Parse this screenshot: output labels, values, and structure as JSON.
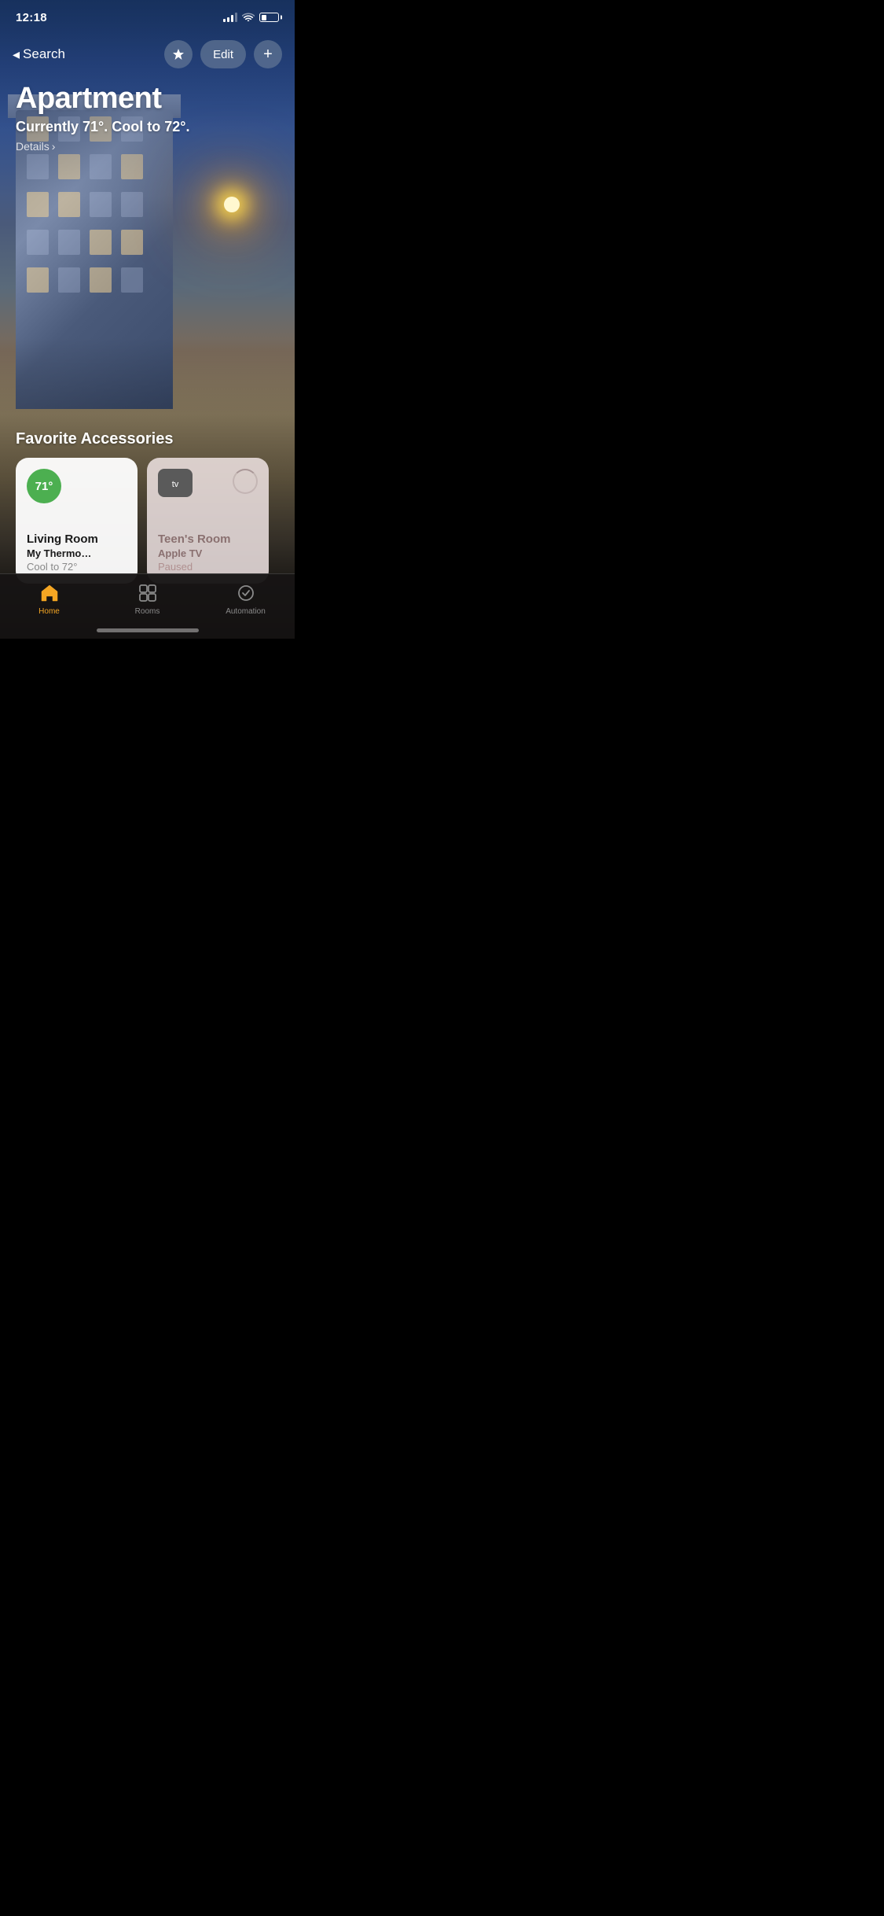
{
  "statusBar": {
    "time": "12:18"
  },
  "nav": {
    "backLabel": "Search",
    "editLabel": "Edit",
    "addLabel": "+"
  },
  "home": {
    "title": "Apartment",
    "subtitle": "Currently 71°. Cool to 72°.",
    "detailsLabel": "Details",
    "chevronRight": "›"
  },
  "favorites": {
    "sectionTitle": "Favorite Accessories",
    "accessories": [
      {
        "id": "thermostat",
        "badge": "71°",
        "name": "Living Room",
        "device": "My Thermo…",
        "status": "Cool to 72°",
        "active": true
      },
      {
        "id": "appletv",
        "name": "Teen's Room",
        "device": "Apple TV",
        "status": "Paused",
        "active": false
      }
    ]
  },
  "tabBar": {
    "tabs": [
      {
        "id": "home",
        "label": "Home",
        "active": true
      },
      {
        "id": "rooms",
        "label": "Rooms",
        "active": false
      },
      {
        "id": "automation",
        "label": "Automation",
        "active": false
      }
    ]
  }
}
